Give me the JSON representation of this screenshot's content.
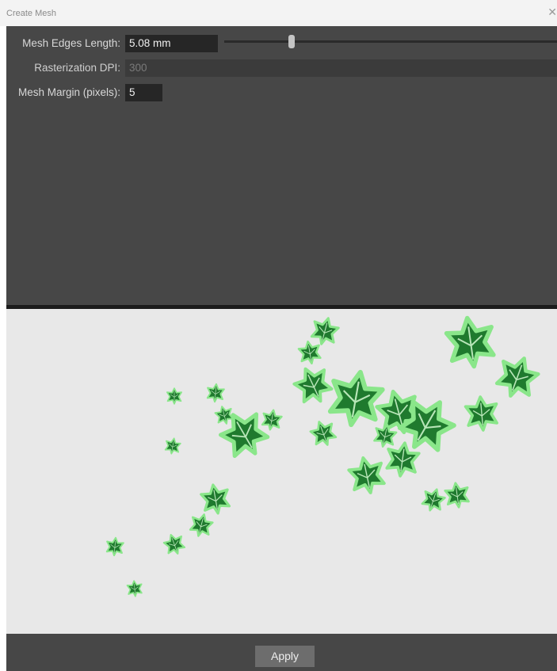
{
  "window": {
    "title": "Create Mesh",
    "close_glyph": "✕",
    "close_icon": "close-icon"
  },
  "settings": {
    "edge_length": {
      "label": "Mesh Edges Length:",
      "value": "5.08 mm"
    },
    "dpi": {
      "label": "Rasterization DPI:",
      "value": "300",
      "disabled": true
    },
    "margin": {
      "label": "Mesh Margin (pixels):",
      "value": "5"
    }
  },
  "preview": {
    "description": "ivy-leaves-mesh-preview"
  },
  "footer": {
    "apply_label": "Apply"
  },
  "colors": {
    "panel": "#474747",
    "field": "#262626",
    "preview_bg": "#e8e8e8",
    "leaf": "#1f7a2e",
    "mesh_outline": "#7fe07f"
  }
}
